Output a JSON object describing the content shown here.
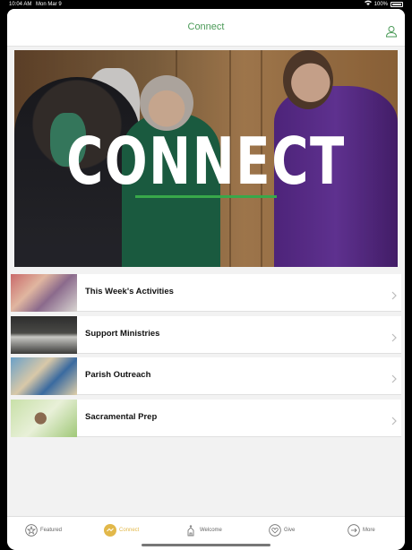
{
  "status_bar": {
    "time": "10:04 AM",
    "date": "Mon Mar 9",
    "battery": "100%"
  },
  "nav": {
    "title": "Connect"
  },
  "hero": {
    "title": "CONNECT"
  },
  "menu": [
    {
      "label": "This Week's Activities"
    },
    {
      "label": "Support Ministries"
    },
    {
      "label": "Parish Outreach"
    },
    {
      "label": "Sacramental Prep"
    }
  ],
  "tabs": [
    {
      "label": "Featured",
      "icon": "star-icon"
    },
    {
      "label": "Connect",
      "icon": "connect-icon",
      "active": true
    },
    {
      "label": "Welcome",
      "icon": "church-icon"
    },
    {
      "label": "Give",
      "icon": "heart-icon"
    },
    {
      "label": "More",
      "icon": "arrow-icon"
    }
  ],
  "colors": {
    "accent_green": "#4a9a57",
    "active_tab": "#e2b84a"
  }
}
